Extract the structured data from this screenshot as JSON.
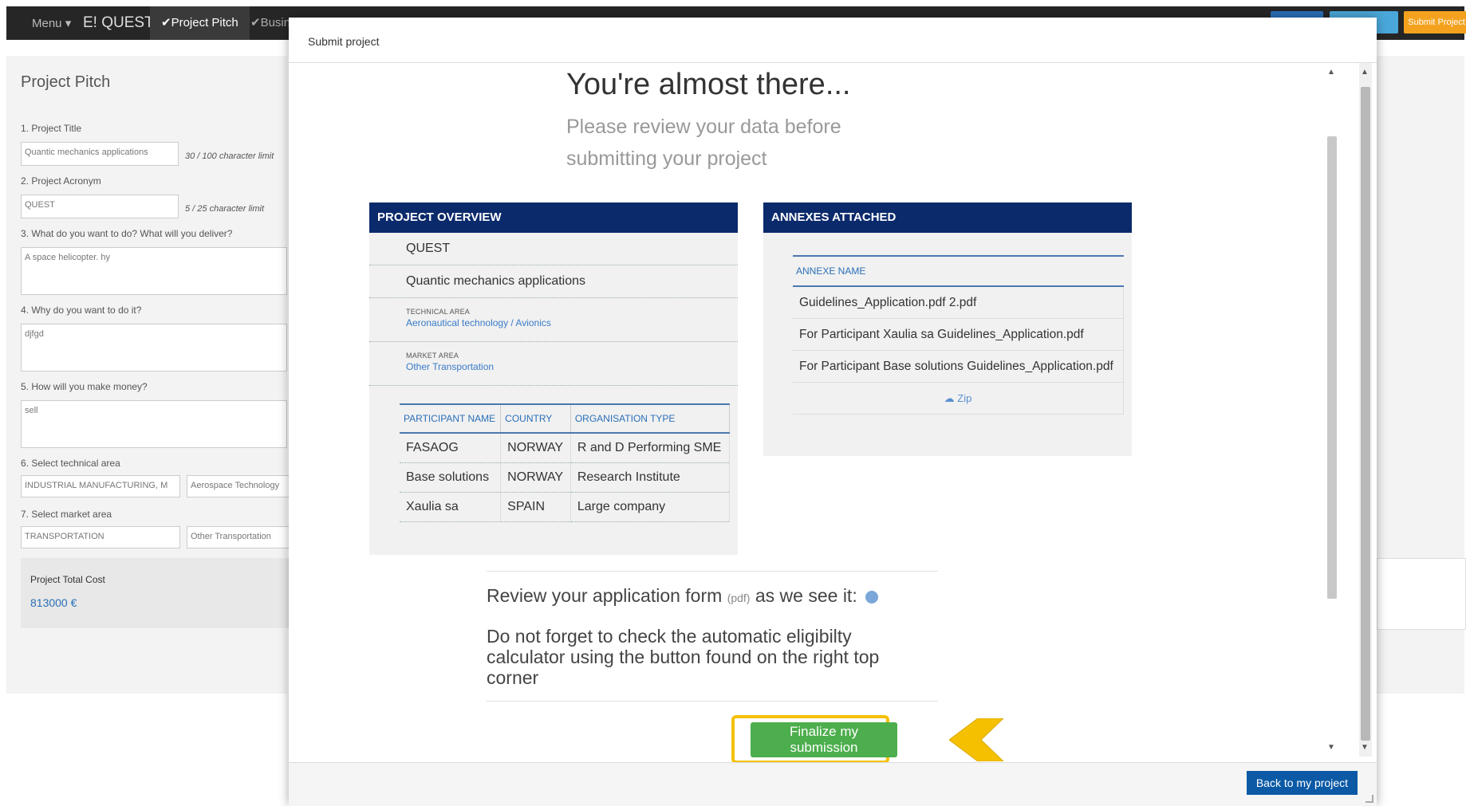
{
  "app": {
    "menu_label": "Menu ▾",
    "brand": "E! QUEST",
    "tabs": [
      "✔Project Pitch",
      "✔Busines"
    ],
    "submit_label": "Submit Project"
  },
  "background_form": {
    "title": "Project Pitch",
    "fields": {
      "project_title_label": "1. Project Title",
      "project_title_value": "Quantic mechanics applications",
      "project_title_hint": "30 / 100 character limit",
      "acronym_label": "2. Project Acronym",
      "acronym_value": "QUEST",
      "acronym_hint": "5 / 25 character limit",
      "q3_label": "3. What do you want to do? What will you deliver?",
      "q3_value": "A space helicopter. hy",
      "q4_label": "4. Why do you want to do it?",
      "q4_value": "djfgd",
      "q5_label": "5. How will you make money?",
      "q5_value": "sell",
      "tech_label": "6. Select technical area",
      "tech_value": "INDUSTRIAL MANUFACTURING, M",
      "tech_sub": "Aerospace Technology",
      "market_label": "7. Select market area",
      "market_value": "TRANSPORTATION",
      "market_sub": "Other Transportation",
      "cost_label": "Project Total Cost",
      "cost_value": "813000 €"
    }
  },
  "modal": {
    "title": "Submit project",
    "heading": "You're almost there...",
    "subheading": "Please review your data before submitting your project",
    "project_overview": {
      "header": "PROJECT OVERVIEW",
      "acronym": "QUEST",
      "title": "Quantic mechanics applications",
      "technical_area_label": "TECHNICAL AREA",
      "technical_area_value": "Aeronautical technology / Avionics",
      "market_area_label": "MARKET AREA",
      "market_area_value": "Other Transportation",
      "participants_columns": [
        "PARTICIPANT NAME",
        "COUNTRY",
        "ORGANISATION TYPE"
      ],
      "participants": [
        {
          "name": "FASAOG",
          "country": "NORWAY",
          "type": "R and D Performing SME"
        },
        {
          "name": "Base solutions",
          "country": "NORWAY",
          "type": "Research Institute"
        },
        {
          "name": "Xaulia sa",
          "country": "SPAIN",
          "type": "Large company"
        }
      ]
    },
    "annexes": {
      "header": "ANNEXES ATTACHED",
      "column": "ANNEXE NAME",
      "files": [
        "Guidelines_Application.pdf 2.pdf",
        "For Participant Xaulia sa Guidelines_Application.pdf",
        "For Participant Base solutions Guidelines_Application.pdf"
      ],
      "zip_label": "Zip"
    },
    "review_text": "Review your application form",
    "review_pdf": "(pdf)",
    "review_suffix": "as we see it:",
    "eligibility_note": "Do not forget to check the automatic eligibilty calculator using the button found on the right top corner",
    "finalize_label": "Finalize my submission",
    "back_label": "Back to my project"
  },
  "colors": {
    "header_navy": "#0b2a6b",
    "finalize_green": "#4cae4c",
    "highlight_yellow": "#f5c000",
    "back_blue": "#0c5aa6"
  }
}
